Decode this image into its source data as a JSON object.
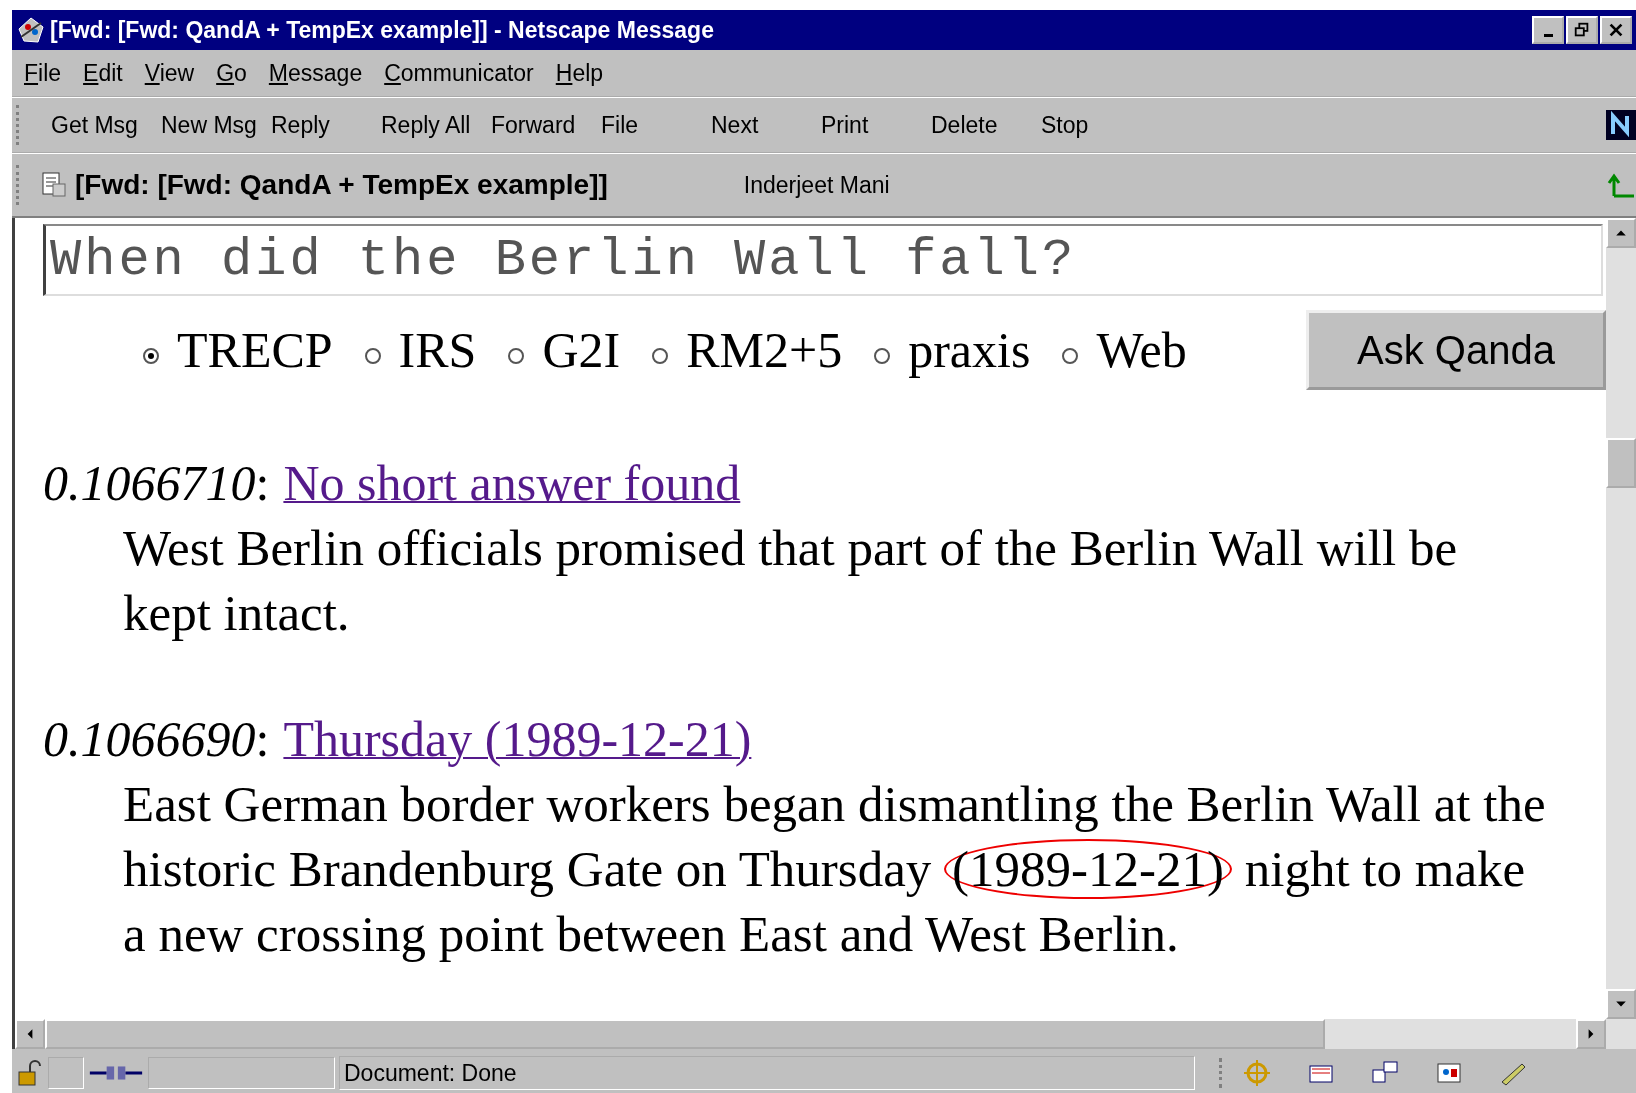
{
  "window": {
    "title": "[Fwd: [Fwd: QandA + TempEx example]] - Netscape Message"
  },
  "menu": [
    "File",
    "Edit",
    "View",
    "Go",
    "Message",
    "Communicator",
    "Help"
  ],
  "toolbar": [
    "Get Msg",
    "New Msg",
    "Reply",
    "Reply All",
    "Forward",
    "File",
    "Next",
    "Print",
    "Delete",
    "Stop"
  ],
  "message_header": {
    "subject": "[Fwd: [Fwd: QandA + TempEx example]]",
    "from": "Inderjeet Mani"
  },
  "question": {
    "value": "When did the Berlin Wall fall?"
  },
  "engines": [
    {
      "label": "TRECP",
      "selected": true
    },
    {
      "label": "IRS",
      "selected": false
    },
    {
      "label": "G2I",
      "selected": false
    },
    {
      "label": "RM2+5",
      "selected": false
    },
    {
      "label": "praxis",
      "selected": false
    },
    {
      "label": "Web",
      "selected": false
    }
  ],
  "ask_button": "Ask Qanda",
  "results": [
    {
      "score": "0.1066710",
      "separator": ":",
      "answer": "No short answer found",
      "snippet": [
        {
          "text": "West Berlin officials promised that part of the Berlin Wall will be kept intact.",
          "circled": false
        }
      ]
    },
    {
      "score": "0.1066690",
      "separator": ":",
      "answer": "Thursday (1989-12-21)",
      "snippet": [
        {
          "text": "East German border workers began dismantling the Berlin Wall at the historic Brandenburg Gate on Thursday",
          "circled": false
        },
        {
          "text": "(1989-12-21)",
          "circled": true
        },
        {
          "text": "night to make a new crossing point between East and West Berlin.",
          "circled": false
        }
      ]
    }
  ],
  "status_bar": {
    "text": "Document: Done"
  }
}
